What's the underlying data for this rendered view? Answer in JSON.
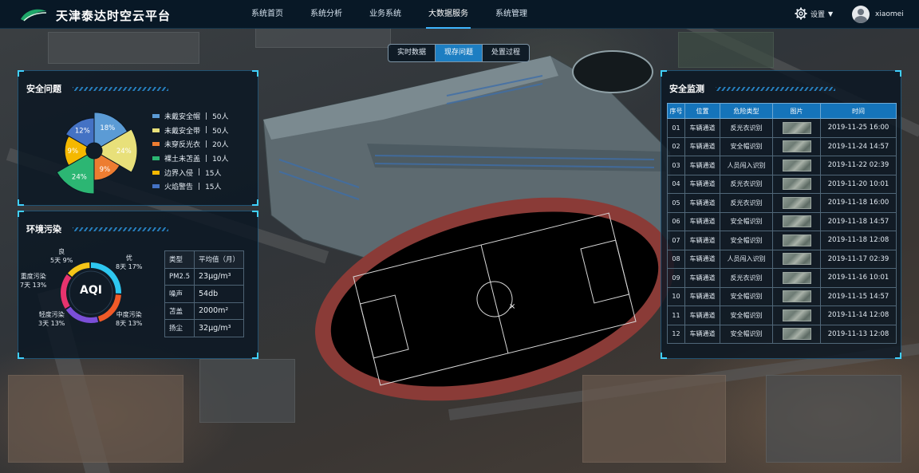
{
  "header": {
    "app_title": "天津泰达时空云平台",
    "nav": [
      {
        "label": "系统首页",
        "active": false
      },
      {
        "label": "系统分析",
        "active": false
      },
      {
        "label": "业务系统",
        "active": false
      },
      {
        "label": "大数据服务",
        "active": true
      },
      {
        "label": "系统管理",
        "active": false
      }
    ],
    "settings_label": "设置",
    "user_name": "xiaomei"
  },
  "data_tabs": [
    {
      "label": "实时数据",
      "active": false
    },
    {
      "label": "现存问题",
      "active": true
    },
    {
      "label": "处置过程",
      "active": false
    }
  ],
  "safety_issues": {
    "title": "安全问题",
    "chart_data": {
      "type": "pie",
      "variant": "rose",
      "slices": [
        {
          "label": "未戴安全帽",
          "count": "50人",
          "value": 18,
          "pct_label": "18%",
          "color": "#5b9bd5"
        },
        {
          "label": "未戴安全带",
          "count": "50人",
          "value": 24,
          "pct_label": "24%",
          "color": "#e8e07a"
        },
        {
          "label": "未穿反光衣",
          "count": "20人",
          "value": 9,
          "pct_label": "9%",
          "color": "#ed7d31"
        },
        {
          "label": "裸土未苫盖",
          "count": "10人",
          "value": 24,
          "pct_label": "24%",
          "color": "#2cb673"
        },
        {
          "label": "边界入侵",
          "count": "15人",
          "value": 9,
          "pct_label": "9%",
          "color": "#f5b800"
        },
        {
          "label": "火焰警告",
          "count": "15人",
          "value": 12,
          "pct_label": "12%",
          "color": "#4472c4"
        }
      ]
    }
  },
  "pollution": {
    "title": "环境污染",
    "aqi_text": "AQI",
    "chart_data": {
      "type": "pie",
      "variant": "donut",
      "slices": [
        {
          "label": "优",
          "detail": "8天 17%",
          "value": 17,
          "color": "#2ec7f0"
        },
        {
          "label": "中度污染",
          "detail": "8天 13%",
          "value": 13,
          "color": "#f05a28"
        },
        {
          "label": "轻度污染",
          "detail": "3天 13%",
          "value": 13,
          "color": "#7b4fd8"
        },
        {
          "label": "重度污染",
          "detail": "7天 13%",
          "value": 13,
          "color": "#e8336e"
        },
        {
          "label": "良",
          "detail": "5天 9%",
          "value": 9,
          "color": "#f5c518"
        }
      ]
    },
    "table": {
      "headers": [
        "类型",
        "平均值（月）"
      ],
      "rows": [
        [
          "PM2.5",
          "23μg/m³"
        ],
        [
          "噪声",
          "54db"
        ],
        [
          "苫盖",
          "2000m²"
        ],
        [
          "扬尘",
          "32μg/m³"
        ]
      ]
    }
  },
  "monitor": {
    "title": "安全监测",
    "headers": [
      "序号",
      "位置",
      "危险类型",
      "图片",
      "时间"
    ],
    "rows": [
      {
        "no": "01",
        "location": "车辆通道",
        "type": "反光衣识别",
        "time": "2019-11-25 16:00"
      },
      {
        "no": "02",
        "location": "车辆通道",
        "type": "安全帽识别",
        "time": "2019-11-24 14:57"
      },
      {
        "no": "03",
        "location": "车辆通道",
        "type": "人员闯入识别",
        "time": "2019-11-22 02:39"
      },
      {
        "no": "04",
        "location": "车辆通道",
        "type": "反光衣识别",
        "time": "2019-11-20 10:01"
      },
      {
        "no": "05",
        "location": "车辆通道",
        "type": "反光衣识别",
        "time": "2019-11-18 16:00"
      },
      {
        "no": "06",
        "location": "车辆通道",
        "type": "安全帽识别",
        "time": "2019-11-18 14:57"
      },
      {
        "no": "07",
        "location": "车辆通道",
        "type": "安全帽识别",
        "time": "2019-11-18 12:08"
      },
      {
        "no": "08",
        "location": "车辆通道",
        "type": "人员闯入识别",
        "time": "2019-11-17 02:39"
      },
      {
        "no": "09",
        "location": "车辆通道",
        "type": "反光衣识别",
        "time": "2019-11-16 10:01"
      },
      {
        "no": "10",
        "location": "车辆通道",
        "type": "安全帽识别",
        "time": "2019-11-15 14:57"
      },
      {
        "no": "11",
        "location": "车辆通道",
        "type": "安全帽识别",
        "time": "2019-11-14 12:08"
      },
      {
        "no": "12",
        "location": "车辆通道",
        "type": "安全帽识别",
        "time": "2019-11-13 12:08"
      }
    ]
  },
  "colors": {
    "accent": "#3fb6ff",
    "header_bg": "#081826",
    "table_header": "#1574ba",
    "field_green": "#000000",
    "track_red": "#8a3b37"
  }
}
